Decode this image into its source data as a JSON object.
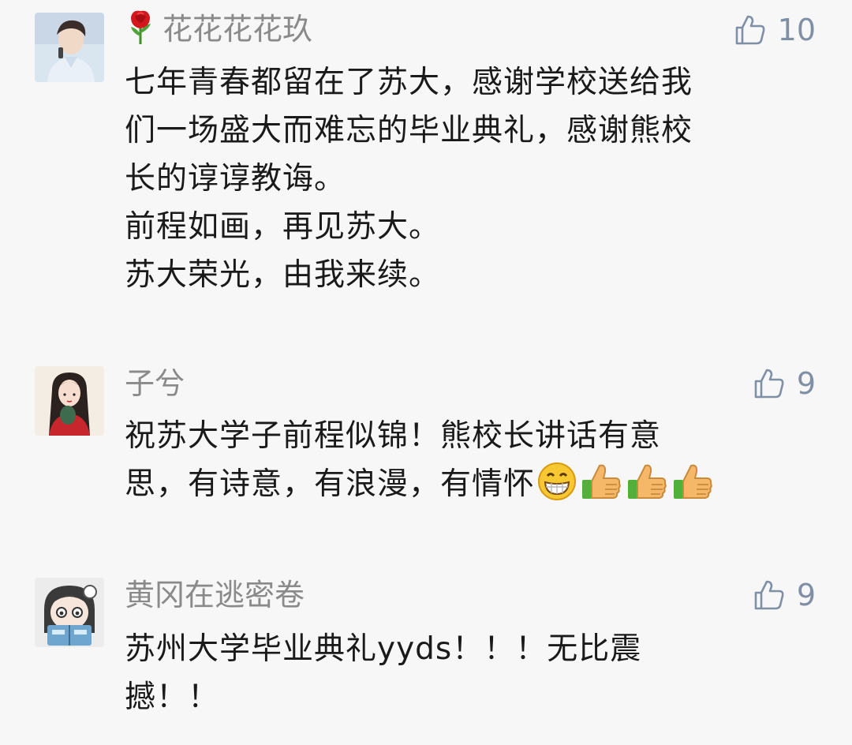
{
  "comments": [
    {
      "username": "花花花花玖",
      "likes": "10",
      "lines": [
        "七年青春都留在了苏大，感谢学校送给我",
        "们一场盛大而难忘的毕业典礼，感谢熊校",
        "长的谆谆教诲。",
        "前程如画，再见苏大。",
        "苏大荣光，由我来续。"
      ]
    },
    {
      "username": "子兮",
      "likes": "9",
      "lines": [
        "祝苏大学子前程似锦！熊校长讲话有意",
        "思，有诗意，有浪漫，有情怀"
      ],
      "emojis": [
        "grin-emoji",
        "thumbs-up-emoji",
        "thumbs-up-emoji",
        "thumbs-up-emoji"
      ]
    },
    {
      "username": "黄冈在逃密卷",
      "likes": "9",
      "lines": [
        "苏州大学毕业典礼yyds！！！无比震",
        "撼！！"
      ]
    }
  ],
  "colors": {
    "background": "#f7f7f7",
    "username": "#8a8a8a",
    "text": "#1a1a1a",
    "like": "#7f8fa6"
  }
}
